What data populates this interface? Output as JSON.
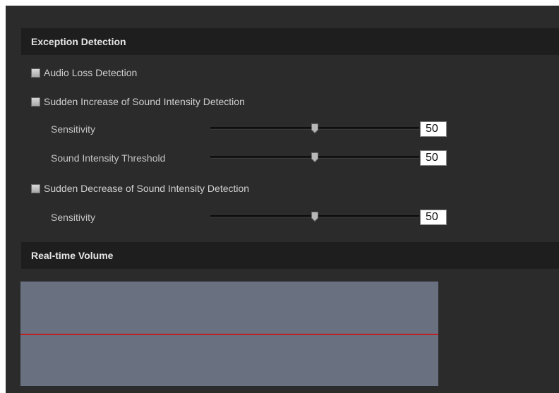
{
  "exception_detection": {
    "title": "Exception Detection",
    "audio_loss": {
      "label": "Audio Loss Detection",
      "checked": false
    },
    "sudden_increase": {
      "label": "Sudden Increase of Sound Intensity Detection",
      "checked": false,
      "sensitivity": {
        "label": "Sensitivity",
        "value": "50",
        "percent": 50
      },
      "threshold": {
        "label": "Sound Intensity Threshold",
        "value": "50",
        "percent": 50
      }
    },
    "sudden_decrease": {
      "label": "Sudden Decrease of Sound Intensity Detection",
      "checked": false,
      "sensitivity": {
        "label": "Sensitivity",
        "value": "50",
        "percent": 50
      }
    }
  },
  "realtime_volume": {
    "title": "Real-time Volume",
    "threshold_level_percent": 50
  },
  "colors": {
    "panel_bg": "#2b2b2b",
    "header_bg": "#1e1e1e",
    "meter_bg": "#697080",
    "threshold_line": "#c02020"
  }
}
